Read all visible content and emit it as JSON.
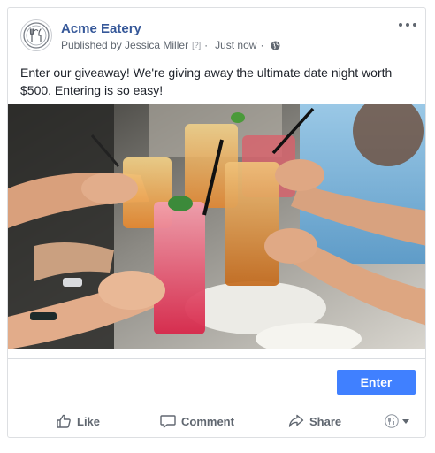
{
  "post": {
    "page_name": "Acme Eatery",
    "published_by": "Published by Jessica Miller",
    "help_marker": "[?]",
    "separator": "·",
    "time": "Just now",
    "text": "Enter our giveaway! We're giving away the ultimate date night worth $500. Entering is so easy!",
    "image_alt": "Friends toasting with colorful drinks"
  },
  "cta": {
    "label": "Enter",
    "color": "#4080ff"
  },
  "actions": {
    "like": "Like",
    "comment": "Comment",
    "share": "Share"
  },
  "icons": {
    "avatar": "restaurant-logo-icon",
    "privacy": "globe-icon",
    "more": "more-options-icon",
    "like": "thumbs-up-icon",
    "comment": "comment-bubble-icon",
    "share": "share-arrow-icon",
    "audience": "page-avatar-dropdown-icon"
  },
  "colors": {
    "page_name": "#365899",
    "meta": "#606770",
    "border": "#dddfe2"
  }
}
